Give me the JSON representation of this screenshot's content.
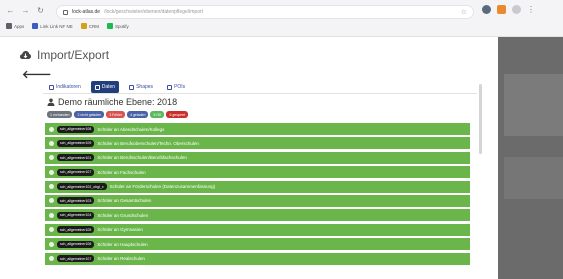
{
  "browser": {
    "url_host": "lock-atlas.de",
    "url_path": "/lock/geschwister/ebenen/datenpflege/import",
    "bookmarks": [
      {
        "label": "Apps",
        "color": "#5f6368"
      },
      {
        "label": "Link Link NF NE",
        "color": "#3b5cc4"
      },
      {
        "label": "CRM",
        "color": "#d4a11a"
      },
      {
        "label": "Spotify",
        "color": "#1db954"
      }
    ]
  },
  "page": {
    "title": "Import/Export"
  },
  "tabs": [
    {
      "label": "Indikatoren",
      "active": false
    },
    {
      "label": "Daten",
      "active": true
    },
    {
      "label": "Shapes",
      "active": false
    },
    {
      "label": "POIs",
      "active": false
    }
  ],
  "section": {
    "title": "Demo räumliche Ebene: 2018"
  },
  "badges": [
    {
      "label": "1 vorhanden",
      "color": "#6c757d"
    },
    {
      "label": "2 nicht geladen",
      "color": "#4a63a6"
    },
    {
      "label": "3 Fehler",
      "color": "#d9534f"
    },
    {
      "label": "4 geladen",
      "color": "#4a63a6"
    },
    {
      "label": "5 OK",
      "color": "#5cb85c"
    },
    {
      "label": "6 gesperrt",
      "color": "#c9302c"
    }
  ],
  "rows": [
    {
      "code": "sch_allgemeiner108",
      "label": "Schüler an Abendschulen/Kollegs"
    },
    {
      "code": "sch_allgemeiner109",
      "label": "Schüler an Berufsoberschulen/Techn. Oberschulen"
    },
    {
      "code": "sch_allgemeiner101",
      "label": "Schüler an Berufsschulen/Berufsfachschulen"
    },
    {
      "code": "sch_allgemeiner107",
      "label": "Schüler an Fachschulen"
    },
    {
      "code": "sch_allgemeiner102_obgl_x",
      "label": "Schüler an Förderschulen (Datenzusammenfassung)"
    },
    {
      "code": "sch_allgemeiner103",
      "label": "Schüler an Gesamtschulen"
    },
    {
      "code": "sch_allgemeiner104",
      "label": "Schüler an Grundschulen"
    },
    {
      "code": "sch_allgemeiner105",
      "label": "Schüler an Gymnasien"
    },
    {
      "code": "sch_allgemeiner106",
      "label": "Schüler an Hauptschulen"
    },
    {
      "code": "sch_allgemeiner107",
      "label": "Schüler an Realschulen"
    }
  ],
  "colors": {
    "row_green": "#6ab64a",
    "active_tab": "#203f7c"
  }
}
